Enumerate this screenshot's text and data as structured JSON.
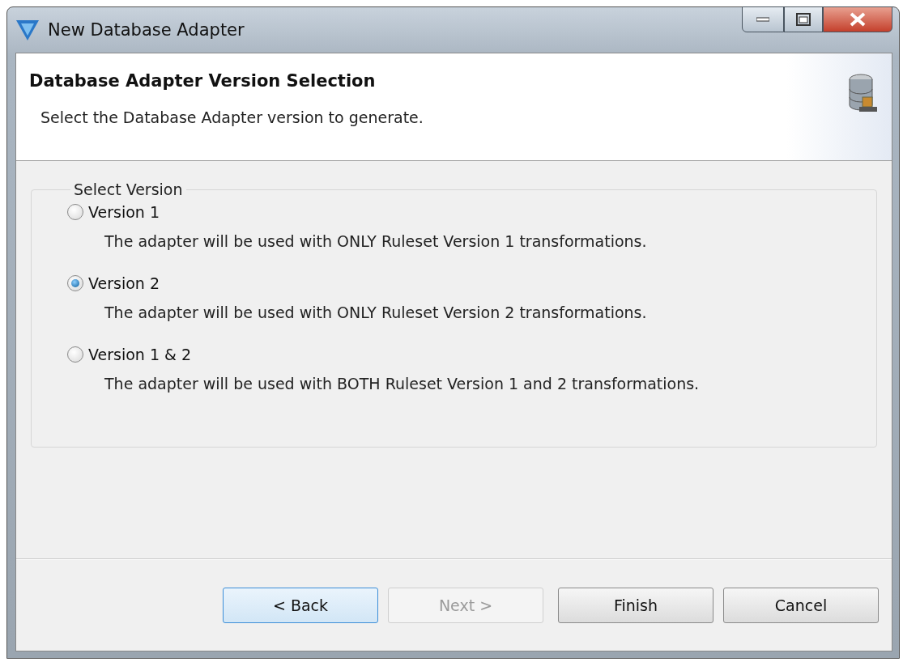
{
  "window": {
    "title": "New Database Adapter"
  },
  "header": {
    "title": "Database Adapter Version Selection",
    "description": "Select the Database Adapter version to generate."
  },
  "group": {
    "label": "Select Version",
    "options": [
      {
        "label": "Version 1",
        "description": "The adapter will be used with ONLY Ruleset Version 1 transformations.",
        "selected": false
      },
      {
        "label": "Version 2",
        "description": "The adapter will be used with ONLY Ruleset Version 2 transformations.",
        "selected": true
      },
      {
        "label": "Version 1 & 2",
        "description": "The adapter will be used with BOTH Ruleset Version 1 and 2 transformations.",
        "selected": false
      }
    ]
  },
  "buttons": [
    {
      "label": "< Back",
      "disabled": false,
      "focused": true
    },
    {
      "label": "Next >",
      "disabled": true,
      "focused": false
    },
    {
      "label": "Finish",
      "disabled": false,
      "focused": false
    },
    {
      "label": "Cancel",
      "disabled": false,
      "focused": false
    }
  ]
}
